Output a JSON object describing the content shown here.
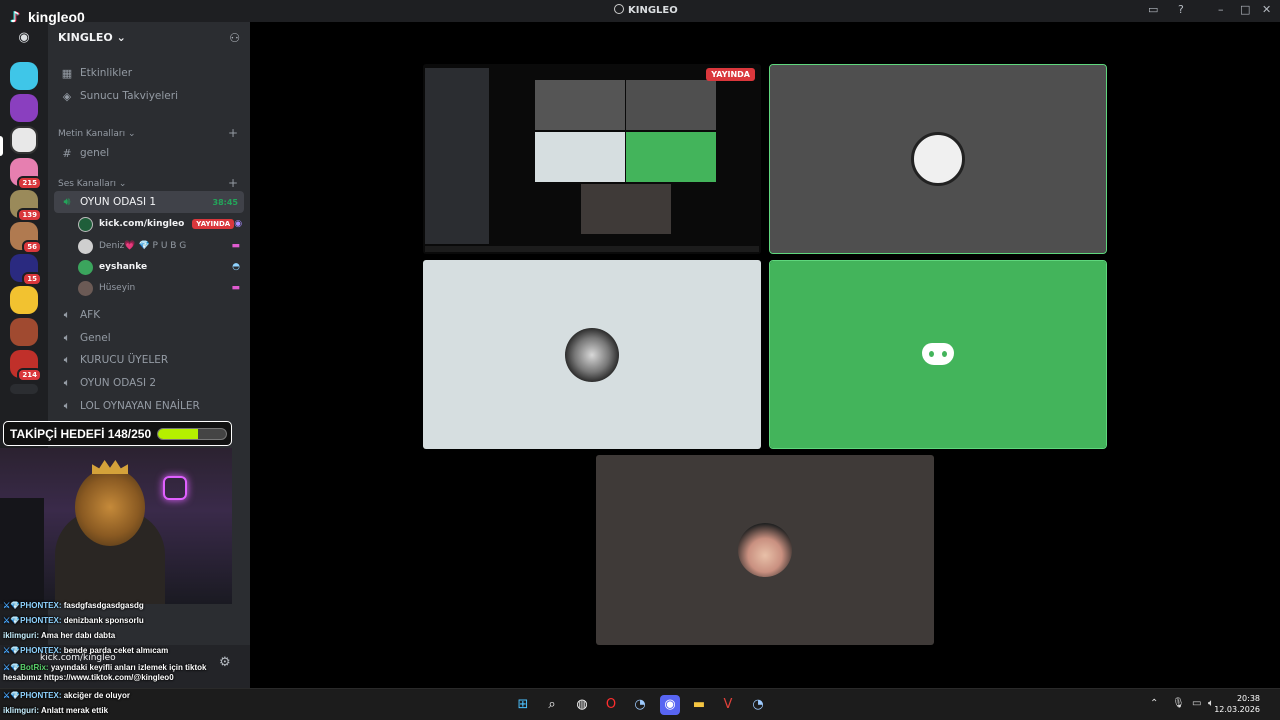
{
  "window": {
    "title": "KINGLEO"
  },
  "overlay": {
    "tiktok_handle": "kingleo0",
    "goal_text": "TAKİPÇİ HEDEFİ 148/250",
    "goal_progress": 0.592
  },
  "rail": {
    "badges": [
      "215",
      "139",
      "56",
      "15",
      "214"
    ]
  },
  "sidebar": {
    "guild_name": "KINGLEO",
    "top_items": [
      "Etkinlikler",
      "Sunucu Takviyeleri"
    ],
    "text_category": "Metin Kanalları",
    "text_channels": [
      "genel"
    ],
    "voice_category": "Ses Kanalları",
    "active_voice": {
      "name": "OYUN ODASI 1",
      "timer": "38:45"
    },
    "members": [
      {
        "name": "kick.com/kingleo",
        "live": "YAYINDA",
        "color": "#1f5e3a"
      },
      {
        "name": "Deniz💗 💎 P U B G",
        "color": "#cfcfcf"
      },
      {
        "name": "eyshanke",
        "color": "#3ba55d"
      },
      {
        "name": "Hüseyin",
        "color": "#6b5a55"
      }
    ],
    "voice_channels": [
      "AFK",
      "Genel",
      "KURUCU ÜYELER",
      "OYUN ODASI 2",
      "LOL OYNAYAN ENAİLER"
    ]
  },
  "chat": [
    {
      "user": "PHONTEX:",
      "text": " fasdgfasdgasdgasdg"
    },
    {
      "user": "PHONTEX:",
      "text": " denizbank sponsorlu"
    },
    {
      "user": "iklimguri:",
      "text": " Ama her dabı dabta"
    },
    {
      "user": "PHONTEX:",
      "text": " bende parda ceket almıcam"
    },
    {
      "user": "BotRix:",
      "text": " yayındaki keyifli anları izlemek için tiktok hesabımız https://www.tiktok.com/@kingleo0"
    },
    {
      "user": "PHONTEX:",
      "text": " akciğer de oluyor"
    },
    {
      "user": "iklimguri:",
      "text": " Anlatt merak ettik"
    }
  ],
  "userpanel": {
    "label": "kick.com/kingleo"
  },
  "stage": {
    "stream_badge": "YAYINDA"
  },
  "colors": {
    "speaking": "#5fd77d",
    "tile_grey": "#4f4f4f",
    "tile_light": "#d6dee0",
    "tile_green": "#43b45b",
    "tile_brown": "#3f3a38"
  },
  "taskbar": {
    "time": "20:38",
    "date": "12.03.2026"
  }
}
